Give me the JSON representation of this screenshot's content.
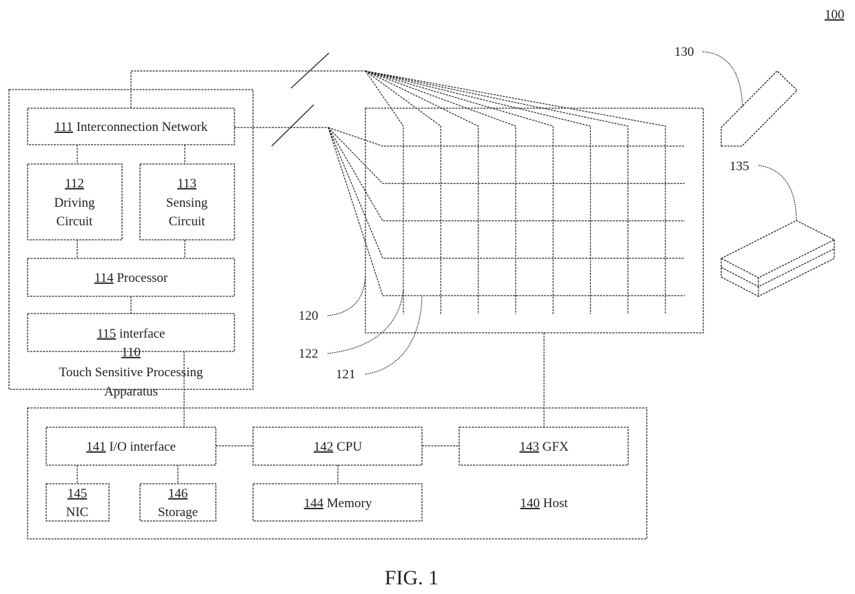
{
  "figure": {
    "ref": "100",
    "caption": "FIG. 1"
  },
  "apparatus": {
    "ref": "110",
    "label_line1": "Touch Sensitive Processing",
    "label_line2": "Apparatus",
    "blocks": {
      "interconnect": {
        "ref": "111",
        "label": "Interconnection Network"
      },
      "driving": {
        "ref": "112",
        "line1": "Driving",
        "line2": "Circuit"
      },
      "sensing": {
        "ref": "113",
        "line1": "Sensing",
        "line2": "Circuit"
      },
      "processor": {
        "ref": "114",
        "label": "Processor"
      },
      "interface": {
        "ref": "115",
        "label": "interface"
      }
    }
  },
  "panel": {
    "ref": "120",
    "first_electrode_ref": "121",
    "second_electrode_ref": "122",
    "vertical_electrode_count": 8,
    "horizontal_electrode_count": 5
  },
  "stylus": {
    "ref": "130"
  },
  "object": {
    "ref": "135"
  },
  "host": {
    "ref": "140",
    "label": "Host",
    "blocks": {
      "io": {
        "ref": "141",
        "label": "I/O interface"
      },
      "cpu": {
        "ref": "142",
        "label": "CPU"
      },
      "gfx": {
        "ref": "143",
        "label": "GFX"
      },
      "memory": {
        "ref": "144",
        "label": "Memory"
      },
      "nic": {
        "ref": "145",
        "label": "NIC"
      },
      "storage": {
        "ref": "146",
        "label": "Storage"
      }
    }
  }
}
